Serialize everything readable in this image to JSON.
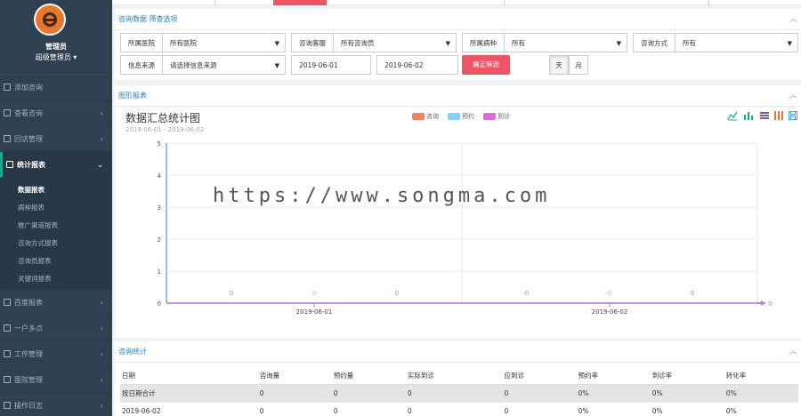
{
  "sidebar": {
    "user_name": "管理员",
    "user_role": "超级管理员 ▾",
    "menu_before": [
      {
        "label": "添加咨询",
        "icon": "plus-square-icon",
        "chev": ""
      },
      {
        "label": "查看咨询",
        "icon": "list-icon",
        "chev": "‹"
      },
      {
        "label": "回访管理",
        "icon": "phone-icon",
        "chev": "‹"
      }
    ],
    "active_menu": {
      "label": "统计报表",
      "icon": "bar-chart-icon",
      "chev": "⌄"
    },
    "submenu": [
      "数据报表",
      "病种报表",
      "推广渠道报表",
      "咨询方式报表",
      "咨询员报表",
      "关键词报表"
    ],
    "menu_after": [
      {
        "label": "百度报表",
        "icon": "baidu-icon",
        "chev": "‹"
      },
      {
        "label": "一户多点",
        "icon": "grid-icon",
        "chev": "‹"
      },
      {
        "label": "工作管理",
        "icon": "briefcase-icon",
        "chev": "‹"
      },
      {
        "label": "医院管理",
        "icon": "hospital-icon",
        "chev": "‹"
      },
      {
        "label": "操作日志",
        "icon": "edit-icon",
        "chev": "‹"
      }
    ]
  },
  "filter": {
    "title": "咨询数据 筛查选项",
    "row1": [
      {
        "label": "所属医院",
        "value": "所有医院"
      },
      {
        "label": "咨询客服",
        "value": "所有咨询员"
      },
      {
        "label": "所属病种",
        "value": "所有"
      },
      {
        "label": "咨询方式",
        "value": "所有"
      }
    ],
    "source_label": "信息来源",
    "source_value": "请选择信息来源",
    "date_from": "2019-06-01",
    "date_to": "2019-06-02",
    "submit": "确定筛选",
    "seg_day": "天",
    "seg_month": "月"
  },
  "chart_panel": {
    "title": "图形报表",
    "chart_title": "数据汇总统计图",
    "chart_sub": "2019-06-01 - 2019-06-02",
    "watermark": "https://www.songma.com"
  },
  "chart_data": {
    "type": "line",
    "title": "数据汇总统计图",
    "subtitle": "2019-06-01 - 2019-06-02",
    "categories": [
      "2019-06-01",
      "2019-06-02"
    ],
    "series": [
      {
        "name": "咨询",
        "color": "#f0825d",
        "values": [
          0,
          0
        ]
      },
      {
        "name": "预约",
        "color": "#87cefa",
        "values": [
          0,
          0
        ]
      },
      {
        "name": "到诊",
        "color": "#da70d6",
        "values": [
          0,
          0
        ]
      }
    ],
    "yticks": [
      "0",
      "1",
      "2",
      "3",
      "4",
      "5"
    ],
    "ylim": [
      0,
      5
    ],
    "grid": true,
    "legend": "top-center"
  },
  "stats": {
    "title": "咨询统计",
    "columns": [
      "日期",
      "咨询量",
      "预约量",
      "实际到诊",
      "应到诊",
      "预约率",
      "到诊率",
      "转化率"
    ],
    "rows": [
      [
        "按日期合计",
        "0",
        "0",
        "0",
        "0",
        "0%",
        "0%",
        "0%"
      ],
      [
        "2019-06-02",
        "0",
        "0",
        "0",
        "0",
        "0%",
        "0%",
        "0%"
      ]
    ]
  },
  "colors": {
    "accent_red": "#ed5565",
    "sidebar_bg": "#2f4050",
    "link_blue": "#337ab7"
  }
}
